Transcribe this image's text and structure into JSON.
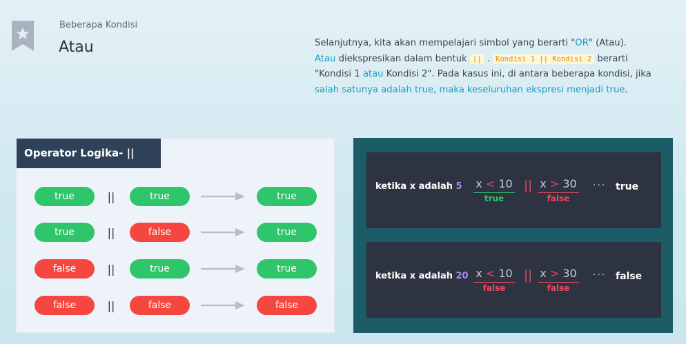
{
  "header": {
    "subtitle": "Beberapa Kondisi",
    "title": "Atau",
    "bookmark_icon": "star-icon"
  },
  "description": {
    "p1": "Selanjutnya, kita akan mempelajari simbol yang berarti \"",
    "or_word": "OR",
    "p2": "\" (Atau).",
    "atau": "Atau",
    "p3": " diekspresikan dalam bentuk ",
    "code_or": "||",
    "p4": " . ",
    "code_expr": "Kondisi 1 || Kondisi 2",
    "p5": " berarti \"Kondisi 1 ",
    "atau2": "atau",
    "p6": " Kondisi 2\". Pada kasus ini, di antara beberapa kondisi, jika ",
    "highlight": "salah satunya adalah true, maka keseluruhan ekspresi menjadi true",
    "p7": "."
  },
  "left_card": {
    "title": "Operator Logika- ||",
    "operator": "||",
    "rows": [
      {
        "a": "true",
        "b": "true",
        "r": "true"
      },
      {
        "a": "true",
        "b": "false",
        "r": "true"
      },
      {
        "a": "false",
        "b": "true",
        "r": "true"
      },
      {
        "a": "false",
        "b": "false",
        "r": "false"
      }
    ]
  },
  "right_card": {
    "examples": [
      {
        "label": "ketika x adalah",
        "value": "5",
        "expr1_x": "x",
        "expr1_op": "<",
        "expr1_n": "10",
        "expr1_res": "true",
        "or": "||",
        "expr2_x": "x",
        "expr2_op": ">",
        "expr2_n": "30",
        "expr2_res": "false",
        "dots": "···",
        "result": "true"
      },
      {
        "label": "ketika x adalah",
        "value": "20",
        "expr1_x": "x",
        "expr1_op": "<",
        "expr1_n": "10",
        "expr1_res": "false",
        "or": "||",
        "expr2_x": "x",
        "expr2_op": ">",
        "expr2_n": "30",
        "expr2_res": "false",
        "dots": "···",
        "result": "false"
      }
    ]
  },
  "colors": {
    "true_pill": "#2fc56b",
    "false_pill": "#f5473f",
    "accent_blue": "#169ec6",
    "header_navy": "#2f4158",
    "teal_panel": "#1b5c67"
  }
}
